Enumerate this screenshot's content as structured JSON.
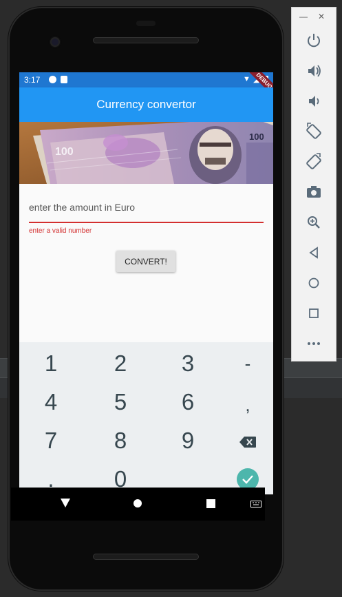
{
  "status_bar": {
    "time": "3:17",
    "debug_label": "DEBUG"
  },
  "app": {
    "title": "Currency convertor",
    "input_placeholder": "enter the amount in Euro",
    "error_text": "enter a valid number",
    "convert_label": "CONVERT!"
  },
  "keyboard": {
    "rows": [
      [
        "1",
        "2",
        "3",
        "-"
      ],
      [
        "4",
        "5",
        "6",
        ","
      ],
      [
        "7",
        "8",
        "9",
        "backspace-icon"
      ],
      [
        ".",
        "0",
        "_",
        "done-check-icon"
      ]
    ]
  },
  "toolbar": {
    "window_buttons": [
      "minimize-icon",
      "close-icon"
    ],
    "icons": [
      "power-icon",
      "volume-up-icon",
      "volume-down-icon",
      "rotate-left-icon",
      "rotate-right-icon",
      "camera-icon",
      "zoom-icon",
      "back-icon",
      "home-icon",
      "overview-icon",
      "more-icon"
    ]
  },
  "colors": {
    "app_bar": "#2196f3",
    "status_bar": "#1f77d1",
    "error": "#d32f2f",
    "button": "#e0e0e0",
    "keyboard_bg": "#eceff1",
    "done_key": "#4db6ac"
  }
}
